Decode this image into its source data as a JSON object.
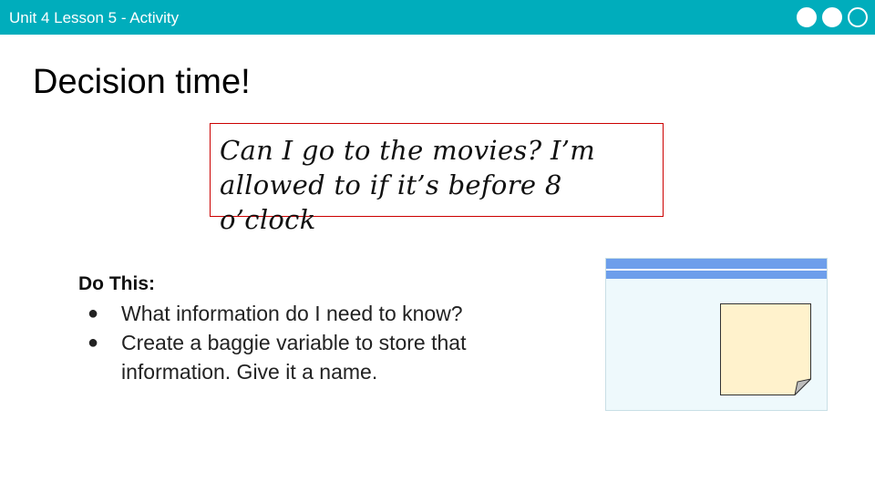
{
  "header": {
    "title": "Unit 4 Lesson 5 - Activity",
    "dots": [
      "filled",
      "filled",
      "open"
    ],
    "bar_color": "#00adbc"
  },
  "main": {
    "heading": "Decision time!",
    "quote": {
      "line1": "Can I go to the movies? I’m",
      "line2": "allowed to if it’s before 8 o’clock",
      "border_color": "#cc0000"
    },
    "instructions": {
      "label": "Do This:",
      "items": [
        "What information do I need to know?",
        "Create a baggie variable to store that information. Give it a name."
      ]
    }
  },
  "illustration": {
    "window_bar_color": "#6d9eeb",
    "sticky_note_color": "#fff2cc"
  }
}
